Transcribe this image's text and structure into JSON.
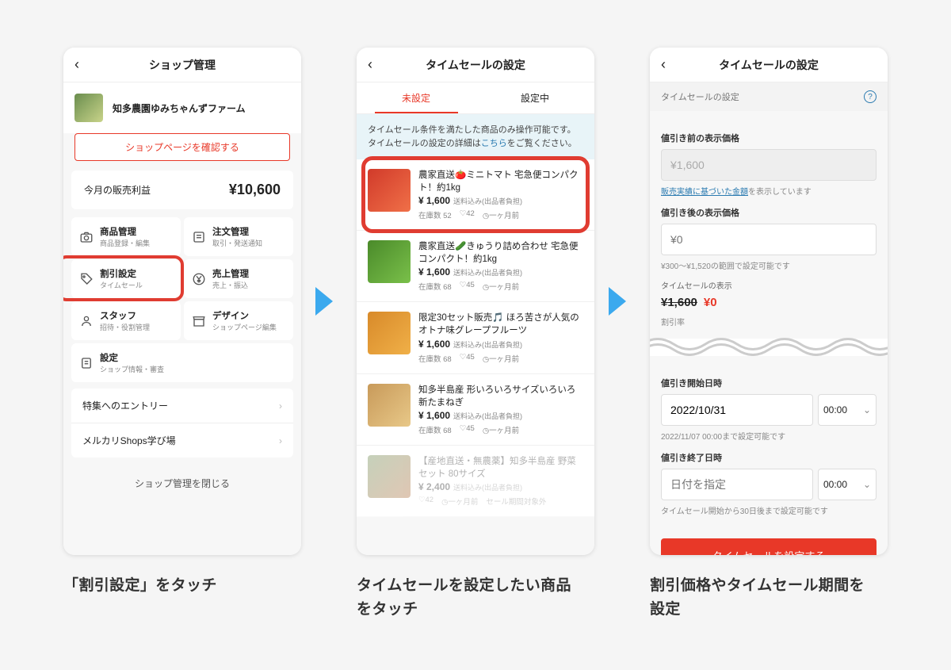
{
  "phone1": {
    "title": "ショップ管理",
    "shop_name": "知多農園ゆみちゃんずファーム",
    "btn_view_shop": "ショップページを確認する",
    "profit_label": "今月の販売利益",
    "profit_amount": "¥10,600",
    "grid": [
      {
        "title": "商品管理",
        "sub": "商品登録・編集"
      },
      {
        "title": "注文管理",
        "sub": "取引・発送通知"
      },
      {
        "title": "割引設定",
        "sub": "タイムセール"
      },
      {
        "title": "売上管理",
        "sub": "売上・振込"
      },
      {
        "title": "スタッフ",
        "sub": "招待・役割管理"
      },
      {
        "title": "デザイン",
        "sub": "ショップページ編集"
      },
      {
        "title": "設定",
        "sub": "ショップ情報・審査"
      }
    ],
    "links": [
      "特集へのエントリー",
      "メルカリShops学び場"
    ],
    "close": "ショップ管理を閉じる"
  },
  "phone2": {
    "title": "タイムセールの設定",
    "tabs": {
      "unset": "未設定",
      "set": "設定中"
    },
    "notice": "タイムセール条件を満たした商品のみ操作可能です。タイムセールの設定の詳細は",
    "notice_link": "こちら",
    "notice_after": "をご覧ください。",
    "items": [
      {
        "title": "農家直送🍅ミニトマト 宅急便コンパクト！約1kg",
        "price": "¥ 1,600",
        "ship": "送料込み(出品者負担)",
        "stock": "在庫数 52",
        "likes": "♡42",
        "age": "◷一ヶ月前"
      },
      {
        "title": "農家直送🥒きゅうり詰め合わせ 宅急便コンパクト！約1kg",
        "price": "¥ 1,600",
        "ship": "送料込み(出品者負担)",
        "stock": "在庫数 68",
        "likes": "♡45",
        "age": "◷一ヶ月前"
      },
      {
        "title": "限定30セット販売🎵 ほろ苦さが人気のオトナ味グレープフルーツ",
        "price": "¥ 1,600",
        "ship": "送料込み(出品者負担)",
        "stock": "在庫数 68",
        "likes": "♡45",
        "age": "◷一ヶ月前"
      },
      {
        "title": "知多半島産 形いろいろサイズいろいろ 新たまねぎ",
        "price": "¥ 1,600",
        "ship": "送料込み(出品者負担)",
        "stock": "在庫数 68",
        "likes": "♡45",
        "age": "◷一ヶ月前"
      },
      {
        "title": "【産地直送・無農薬】知多半島産 野菜セット 80サイズ",
        "price": "¥ 2,400",
        "ship": "送料込み(出品者負担)",
        "stock": "♡42",
        "likes": "◷一ヶ月前",
        "age": "セール期間対象外"
      }
    ]
  },
  "phone3": {
    "title": "タイムセールの設定",
    "section": "タイムセールの設定",
    "label_before": "値引き前の表示価格",
    "price_before": "¥1,600",
    "hint_before": "販売実績に基づいた金額",
    "hint_before_after": "を表示しています",
    "label_after": "値引き後の表示価格",
    "price_after_placeholder": "¥0",
    "hint_after": "¥300〜¥1,520の範囲で設定可能です",
    "display_label": "タイムセールの表示",
    "strike_price": "¥1,600",
    "new_price": "¥0",
    "rate_label": "割引率",
    "label_start": "値引き開始日時",
    "start_date": "2022/10/31",
    "start_time": "00:00",
    "hint_start": "2022/11/07 00:00まで設定可能です",
    "label_end": "値引き終了日時",
    "end_date_placeholder": "日付を指定",
    "end_time": "00:00",
    "hint_end": "タイムセール開始から30日後まで設定可能です",
    "submit": "タイムセールを設定する"
  },
  "captions": {
    "c1": "「割引設定」をタッチ",
    "c2": "タイムセールを設定したい商品をタッチ",
    "c3": "割引価格やタイムセール期間を設定"
  },
  "colors": {
    "tomato": "linear-gradient(135deg,#d13a2a,#f07048)",
    "cucumber": "linear-gradient(135deg,#4a8a2a,#7ac04a)",
    "citrus": "linear-gradient(135deg,#d88a2a,#f0b048)",
    "onion": "linear-gradient(135deg,#c89a5a,#e8c888)",
    "veg": "linear-gradient(135deg,#5a7a3a,#a8602a)"
  }
}
